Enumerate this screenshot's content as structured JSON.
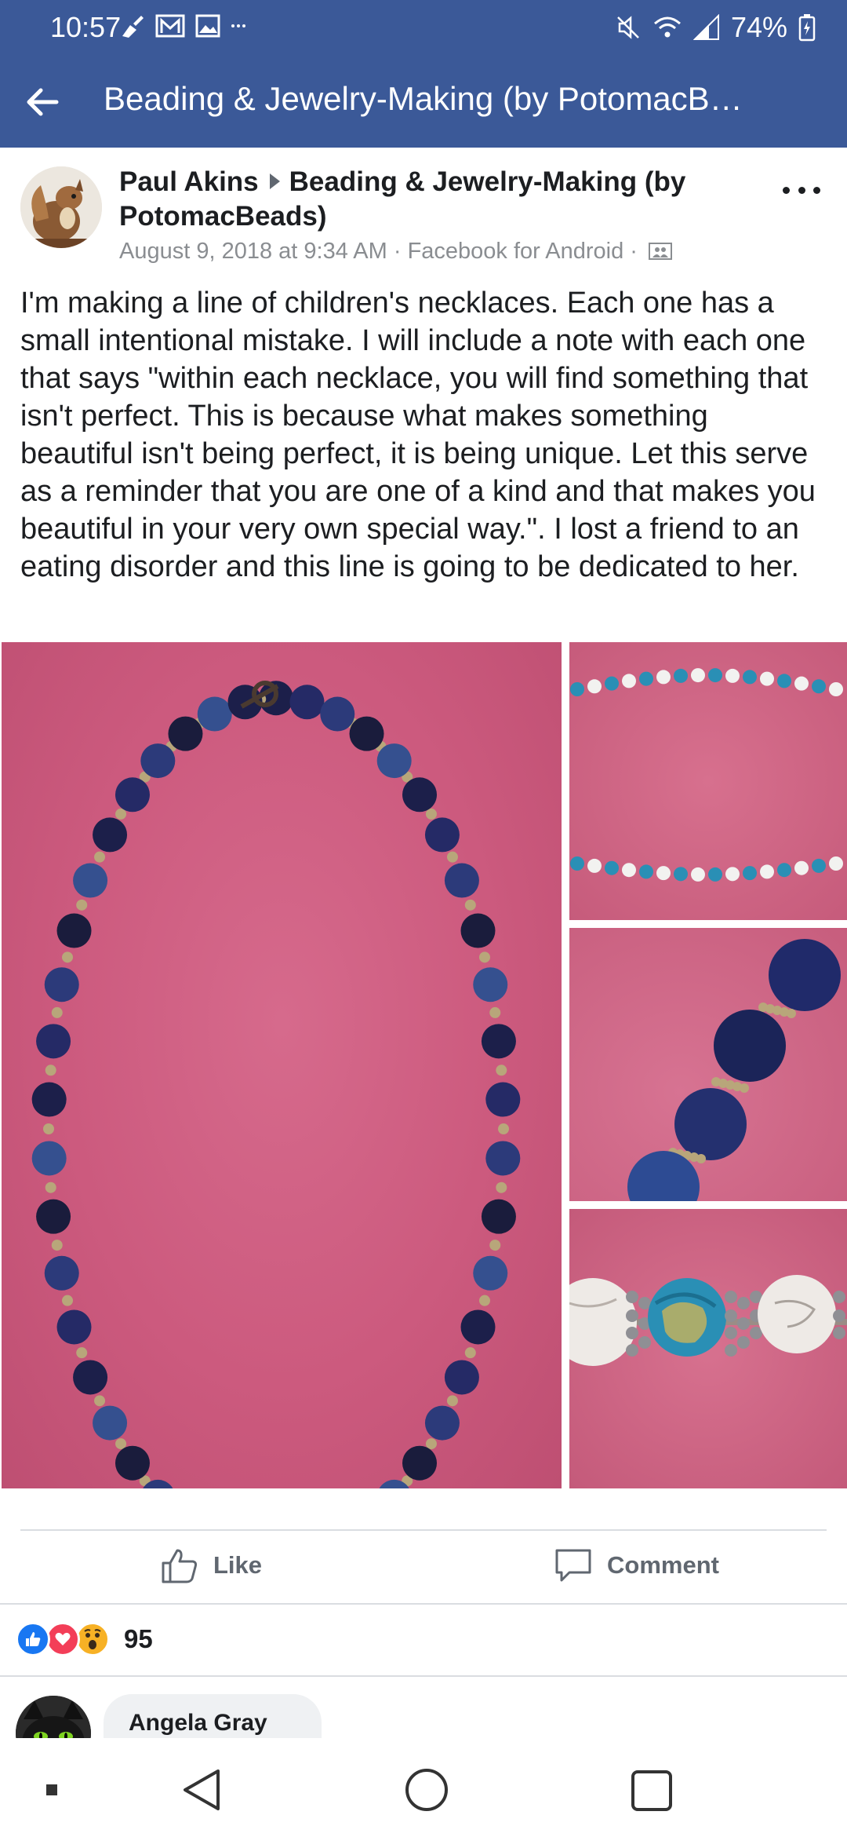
{
  "status_bar": {
    "time": "10:57",
    "battery": "74%"
  },
  "app_bar": {
    "title": "Beading & Jewelry-Making (by PotomacBe..."
  },
  "post": {
    "author": "Paul Akins",
    "group": "Beading & Jewelry-Making (by PotomacBeads)",
    "meta": "August 9, 2018 at 9:34 AM · Facebook for Android ·",
    "text": "I'm making a line of children's necklaces. Each one has a small intentional mistake. I will include a note with each one that says \"within each necklace, you will find something that isn't perfect. This is because what makes something beautiful isn't being perfect, it is being unique. Let this serve as a reminder that you are one of a kind and that makes you beautiful in your very own special way.\". I lost a friend to an eating disorder and this line is going to be dedicated to her."
  },
  "actions": {
    "like_label": "Like",
    "comment_label": "Comment"
  },
  "reactions": {
    "types": [
      "like",
      "love",
      "wow"
    ],
    "count": "95"
  },
  "comment_preview": {
    "author": "Angela Gray"
  },
  "colors": {
    "brand": "#3b5998",
    "like_blue": "#1877f2",
    "love_red": "#f33e58",
    "wow_yellow": "#f7b125",
    "photo_pink": "#cc5a7e"
  }
}
